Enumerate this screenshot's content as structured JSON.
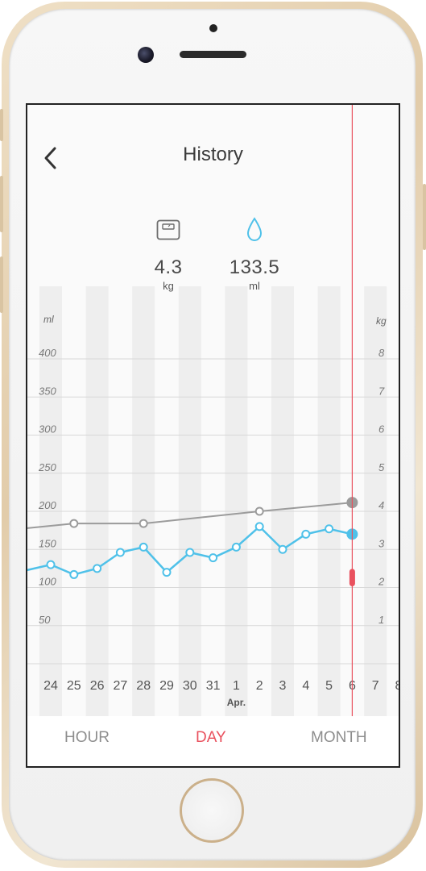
{
  "header": {
    "title": "History",
    "back_icon": "chevron-left-icon"
  },
  "metrics": [
    {
      "icon": "scale-icon",
      "value": "4.3",
      "unit": "kg"
    },
    {
      "icon": "water-drop-icon",
      "value": "133.5",
      "unit": "ml"
    }
  ],
  "chart_data": {
    "type": "line",
    "x_labels": [
      "24",
      "25",
      "26",
      "27",
      "28",
      "29",
      "30",
      "31",
      "1",
      "2",
      "3",
      "4",
      "5",
      "6",
      "7",
      "8"
    ],
    "month_label": "Apr.",
    "y_left": {
      "label": "ml",
      "ticks": [
        50,
        100,
        150,
        200,
        250,
        300,
        350,
        400
      ],
      "range": [
        0,
        400
      ]
    },
    "y_right": {
      "label": "kg",
      "ticks": [
        1,
        2,
        3,
        4,
        5,
        6,
        7,
        8
      ],
      "range": [
        0,
        8
      ]
    },
    "series": [
      {
        "axis": "left",
        "color": "#4fc1e9",
        "x": [
          "23",
          "24",
          "25",
          "26",
          "27",
          "28",
          "29",
          "30",
          "31",
          "1",
          "2",
          "3",
          "4",
          "5",
          "6"
        ],
        "values": [
          122,
          130,
          117,
          125,
          146,
          153,
          120,
          146,
          139,
          153,
          180,
          150,
          170,
          177,
          170
        ]
      },
      {
        "axis": "right",
        "color": "#9b9b9b",
        "x": [
          "23",
          "25",
          "28",
          "2",
          "6"
        ],
        "values": [
          3.55,
          3.68,
          3.68,
          4.0,
          4.23
        ]
      }
    ],
    "selected": {
      "x": "6",
      "color": "#e9515e"
    },
    "range_marker": {
      "x": "6",
      "range": [
        2,
        2.5
      ],
      "axis": "right",
      "color": "#e9515e"
    }
  },
  "tabs": [
    {
      "label": "HOUR",
      "active": false
    },
    {
      "label": "DAY",
      "active": true
    },
    {
      "label": "MONTH",
      "active": false
    }
  ],
  "colors": {
    "accent": "#e9515e",
    "water": "#4fc1e9",
    "weight": "#9b9b9b"
  }
}
